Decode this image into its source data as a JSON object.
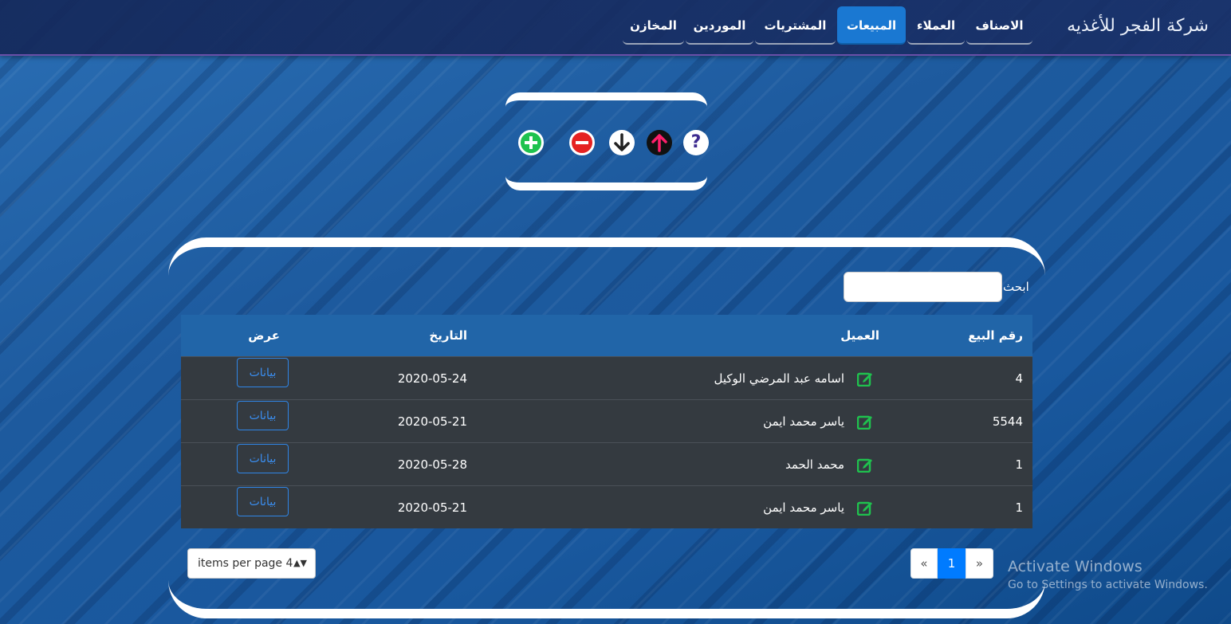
{
  "navbar": {
    "brand": "شركة الفجر للأغذيه",
    "items": [
      {
        "label": "الاصناف",
        "active": false
      },
      {
        "label": "العملاء",
        "active": false
      },
      {
        "label": "المبيعات",
        "active": true
      },
      {
        "label": "المشتريات",
        "active": false
      },
      {
        "label": "الموردين",
        "active": false
      },
      {
        "label": "المخازن",
        "active": false
      }
    ]
  },
  "toolbar": {
    "icons": [
      "help-icon",
      "upload-icon",
      "download-icon",
      "remove-icon",
      "add-icon"
    ],
    "colors": {
      "help": "#3d2a8f",
      "upload": "#ff1f6b",
      "add": "#1fc24e",
      "remove": "#e52222"
    }
  },
  "search": {
    "label": "ابحث",
    "value": ""
  },
  "table": {
    "headers": [
      "رقم البيع",
      "العميل",
      "التاريخ",
      "عرض"
    ],
    "view_label": "بيانات",
    "rows": [
      {
        "id": "4",
        "customer": "اسامه عبد المرضي الوكيل",
        "date": "2020-05-24"
      },
      {
        "id": "5544",
        "customer": "ياسر محمد ايمن",
        "date": "2020-05-21"
      },
      {
        "id": "1",
        "customer": "محمد الحمد",
        "date": "2020-05-28"
      },
      {
        "id": "1",
        "customer": "ياسر محمد ايمن",
        "date": "2020-05-21"
      }
    ]
  },
  "pagination": {
    "per_page": "items per page 4",
    "prev": "«",
    "current": "1",
    "next": "»"
  },
  "watermark": {
    "title": "Activate Windows",
    "subtitle": "Go to Settings to activate Windows."
  }
}
